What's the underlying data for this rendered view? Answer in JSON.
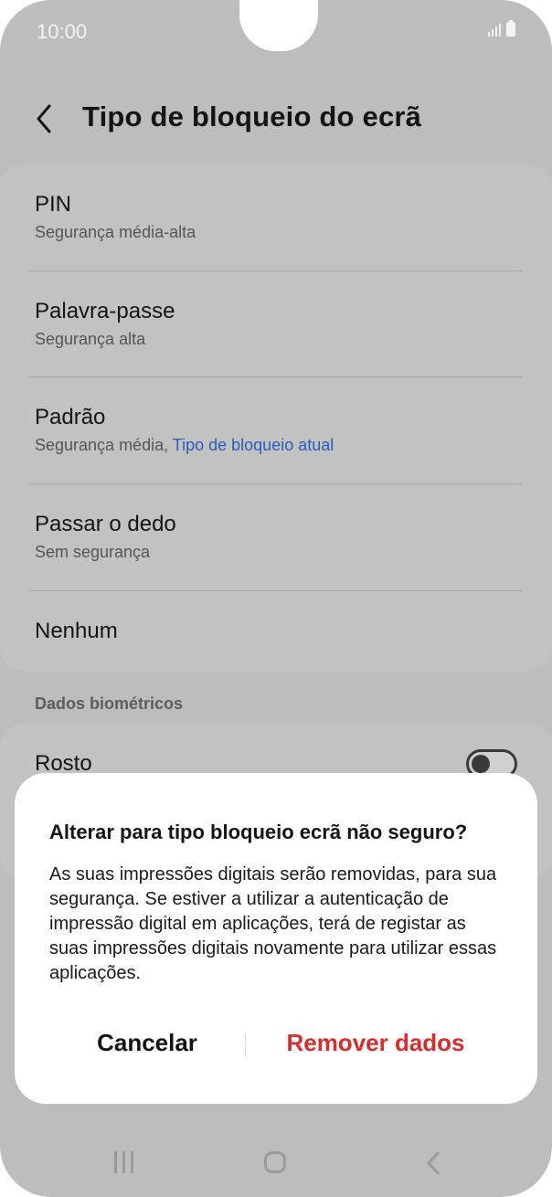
{
  "status_bar": {
    "time": "10:00"
  },
  "header": {
    "title": "Tipo de bloqueio do ecrã"
  },
  "lock_types": [
    {
      "title": "PIN",
      "subtitle": "Segurança média-alta"
    },
    {
      "title": "Palavra-passe",
      "subtitle": "Segurança alta"
    },
    {
      "title": "Padrão",
      "subtitle": "Segurança média,",
      "current_label": "Tipo de bloqueio atual"
    },
    {
      "title": "Passar o dedo",
      "subtitle": "Sem segurança"
    },
    {
      "title": "Nenhum"
    }
  ],
  "biometrics": {
    "section_label": "Dados biométricos",
    "face_label": "Rosto",
    "face_enabled": false
  },
  "dialog": {
    "title": "Alterar para tipo bloqueio ecrã não seguro?",
    "body": "As suas impressões digitais serão removidas, para sua segurança. Se estiver a utilizar a autenticação de impressão digital em aplicações, terá de registar as suas impressões digitais novamente para utilizar essas aplicações.",
    "cancel_label": "Cancelar",
    "confirm_label": "Remover dados"
  },
  "colors": {
    "accent_blue": "#2a5bbd",
    "destructive_red": "#d32f2f",
    "dim_background": "#bdbdbd"
  }
}
